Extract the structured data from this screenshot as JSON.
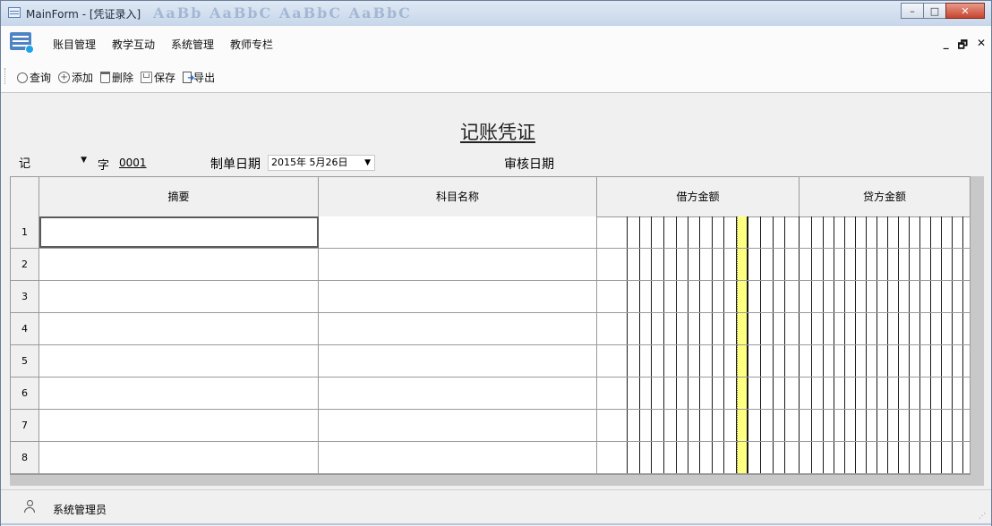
{
  "window": {
    "title": "MainForm - [凭证录入]",
    "ribbon_ghost_text": "AaBb  AaBbC  AaBbC  AaBbC"
  },
  "caption_buttons": {
    "minimize": "–",
    "maximize": "□",
    "close": "✕"
  },
  "menu": {
    "items": [
      "账目管理",
      "教学互动",
      "系统管理",
      "教师专栏"
    ]
  },
  "mdi_buttons": {
    "minimize": "_",
    "restore": "🗗",
    "close": "✕"
  },
  "toolbar": {
    "items": [
      {
        "label": "查询",
        "icon": "search-icon"
      },
      {
        "label": "添加",
        "icon": "add-icon"
      },
      {
        "label": "删除",
        "icon": "delete-icon"
      },
      {
        "label": "保存",
        "icon": "save-icon"
      },
      {
        "label": "导出",
        "icon": "export-icon"
      }
    ]
  },
  "voucher": {
    "title": "记账凭证",
    "type_value": "记",
    "zi_label": "字",
    "number": "0001",
    "date_label": "制单日期",
    "date_value": "2015年  5月26日",
    "audit_label": "审核日期"
  },
  "grid": {
    "columns": [
      "摘要",
      "科目名称",
      "借方金额",
      "贷方金额"
    ],
    "rows": [
      {
        "num": "1",
        "summary": "",
        "account": "",
        "debit": "",
        "credit": ""
      },
      {
        "num": "2",
        "summary": "",
        "account": "",
        "debit": "",
        "credit": ""
      },
      {
        "num": "3",
        "summary": "",
        "account": "",
        "debit": "",
        "credit": ""
      },
      {
        "num": "4",
        "summary": "",
        "account": "",
        "debit": "",
        "credit": ""
      },
      {
        "num": "5",
        "summary": "",
        "account": "",
        "debit": "",
        "credit": ""
      },
      {
        "num": "6",
        "summary": "",
        "account": "",
        "debit": "",
        "credit": ""
      },
      {
        "num": "7",
        "summary": "",
        "account": "",
        "debit": "",
        "credit": ""
      },
      {
        "num": "8",
        "summary": "",
        "account": "",
        "debit": "",
        "credit": ""
      }
    ],
    "highlight_color": "#ffff80"
  },
  "status": {
    "user": "系统管理员"
  }
}
